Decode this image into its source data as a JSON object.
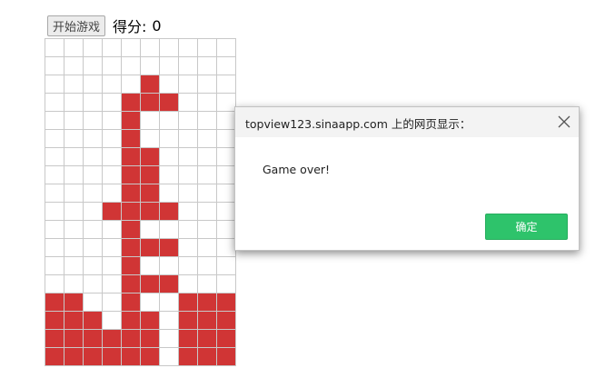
{
  "toolbar": {
    "start_button_label": "开始游戏",
    "score_label": "得分:",
    "score_value": "0"
  },
  "board": {
    "columns": 10,
    "rows": 18,
    "fill_color": "#d03535",
    "grid_line_color": "#c8c8c8",
    "filled_cells": [
      [
        2,
        5
      ],
      [
        3,
        4
      ],
      [
        3,
        5
      ],
      [
        3,
        6
      ],
      [
        4,
        4
      ],
      [
        5,
        4
      ],
      [
        6,
        4
      ],
      [
        6,
        5
      ],
      [
        7,
        4
      ],
      [
        7,
        5
      ],
      [
        8,
        4
      ],
      [
        8,
        5
      ],
      [
        9,
        3
      ],
      [
        9,
        4
      ],
      [
        9,
        5
      ],
      [
        9,
        6
      ],
      [
        10,
        4
      ],
      [
        11,
        4
      ],
      [
        11,
        5
      ],
      [
        11,
        6
      ],
      [
        12,
        4
      ],
      [
        13,
        4
      ],
      [
        13,
        5
      ],
      [
        13,
        6
      ],
      [
        14,
        0
      ],
      [
        14,
        1
      ],
      [
        14,
        4
      ],
      [
        14,
        7
      ],
      [
        14,
        8
      ],
      [
        14,
        9
      ],
      [
        15,
        0
      ],
      [
        15,
        1
      ],
      [
        15,
        2
      ],
      [
        15,
        4
      ],
      [
        15,
        5
      ],
      [
        15,
        7
      ],
      [
        15,
        8
      ],
      [
        15,
        9
      ],
      [
        16,
        0
      ],
      [
        16,
        1
      ],
      [
        16,
        2
      ],
      [
        16,
        3
      ],
      [
        16,
        4
      ],
      [
        16,
        5
      ],
      [
        16,
        7
      ],
      [
        16,
        8
      ],
      [
        16,
        9
      ],
      [
        17,
        0
      ],
      [
        17,
        1
      ],
      [
        17,
        2
      ],
      [
        17,
        3
      ],
      [
        17,
        4
      ],
      [
        17,
        5
      ],
      [
        17,
        7
      ],
      [
        17,
        8
      ],
      [
        17,
        9
      ]
    ]
  },
  "dialog": {
    "title": "topview123.sinaapp.com 上的网页显示：",
    "message": "Game over!",
    "ok_label": "确定",
    "ok_color": "#2ec36b",
    "close_icon": "close-icon"
  }
}
